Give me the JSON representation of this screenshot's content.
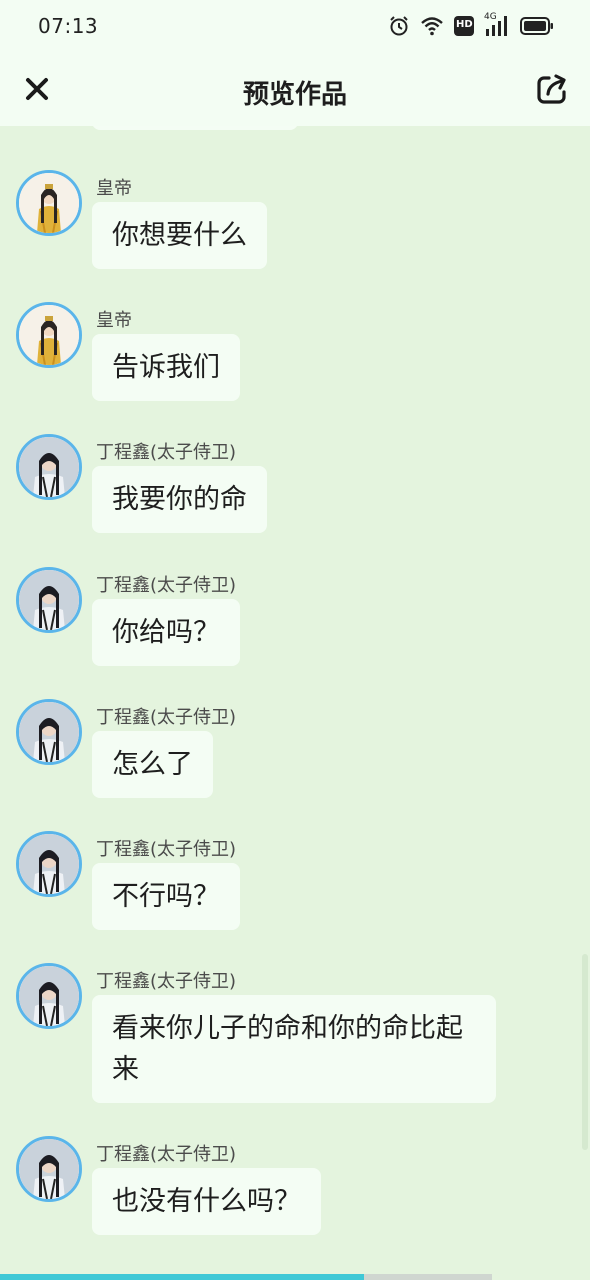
{
  "status_bar": {
    "time": "07:13",
    "icons": [
      "alarm-icon",
      "wifi-icon",
      "hd-icon",
      "4g-signal-icon",
      "battery-icon"
    ],
    "network_label": "4G",
    "hd_label": "HD"
  },
  "header": {
    "title": "预览作品",
    "close_icon": "close-icon",
    "share_icon": "share-icon"
  },
  "messages": [
    {
      "sender": "皇帝",
      "text": "你想要什么",
      "avatar": "emperor"
    },
    {
      "sender": "皇帝",
      "text": "告诉我们",
      "avatar": "emperor"
    },
    {
      "sender": "丁程鑫(太子侍卫)",
      "text": "我要你的命",
      "avatar": "guard"
    },
    {
      "sender": "丁程鑫(太子侍卫)",
      "text": "你给吗？",
      "avatar": "guard"
    },
    {
      "sender": "丁程鑫(太子侍卫)",
      "text": "怎么了",
      "avatar": "guard"
    },
    {
      "sender": "丁程鑫(太子侍卫)",
      "text": "不行吗？",
      "avatar": "guard"
    },
    {
      "sender": "丁程鑫(太子侍卫)",
      "text": "看来你儿子的命和你的命比起来",
      "avatar": "guard"
    },
    {
      "sender": "丁程鑫(太子侍卫)",
      "text": "也没有什么吗？",
      "avatar": "guard"
    }
  ],
  "progress": {
    "value": 0.74
  },
  "colors": {
    "background": "#e4f4de",
    "bubble": "#f4fdf4",
    "avatar_ring": "#5ab5ea",
    "progress_fill": "#3fc8d6"
  }
}
